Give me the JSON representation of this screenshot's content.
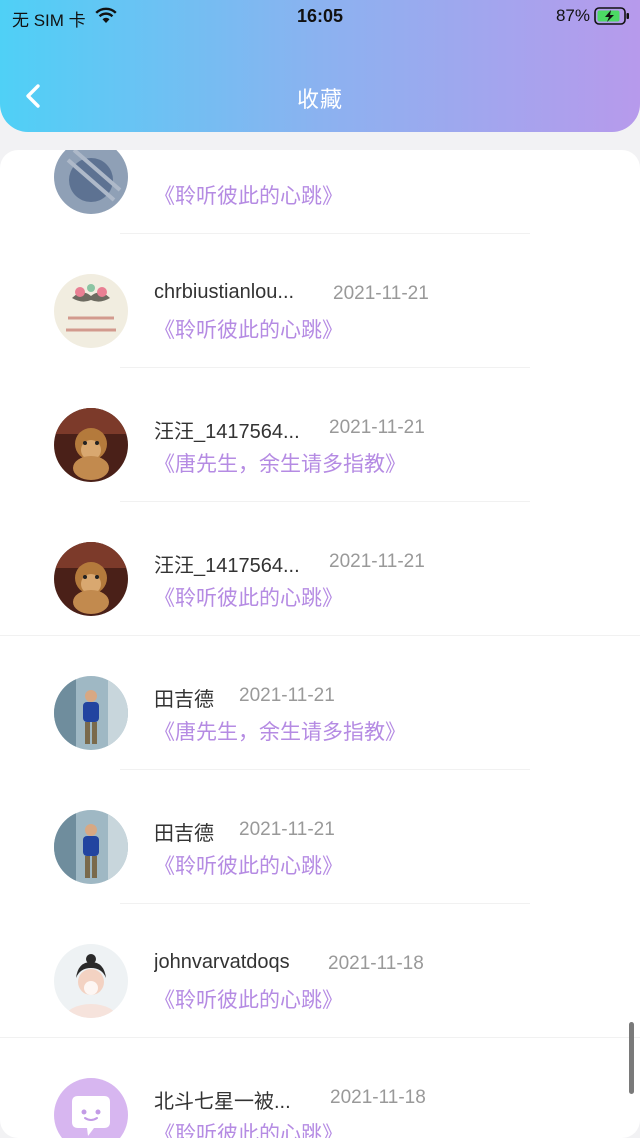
{
  "status_bar": {
    "carrier": "无 SIM 卡",
    "time": "16:05",
    "battery": "87%"
  },
  "header": {
    "title": "收藏"
  },
  "items": [
    {
      "name": "",
      "date": "",
      "title": "《聆听彼此的心跳》",
      "avatar": "avatar-partial"
    },
    {
      "name": "chrbiustianlou...",
      "date": "2021-11-21",
      "title": "《聆听彼此的心跳》",
      "avatar": "avatar-mustache"
    },
    {
      "name": "汪汪_1417564...",
      "date": "2021-11-21",
      "title": "《唐先生，余生请多指教》",
      "avatar": "avatar-dog"
    },
    {
      "name": "汪汪_1417564...",
      "date": "2021-11-21",
      "title": "《聆听彼此的心跳》",
      "avatar": "avatar-dog"
    },
    {
      "name": "田吉德",
      "date": "2021-11-21",
      "title": "《唐先生，余生请多指教》",
      "avatar": "avatar-man"
    },
    {
      "name": "田吉德",
      "date": "2021-11-21",
      "title": "《聆听彼此的心跳》",
      "avatar": "avatar-man"
    },
    {
      "name": "johnvarvatdoqs",
      "date": "2021-11-18",
      "title": "《聆听彼此的心跳》",
      "avatar": "avatar-girl"
    },
    {
      "name": "北斗七星一被...",
      "date": "2021-11-18",
      "title": "《聆听彼此的心跳》",
      "avatar": "avatar-default-chat"
    }
  ]
}
